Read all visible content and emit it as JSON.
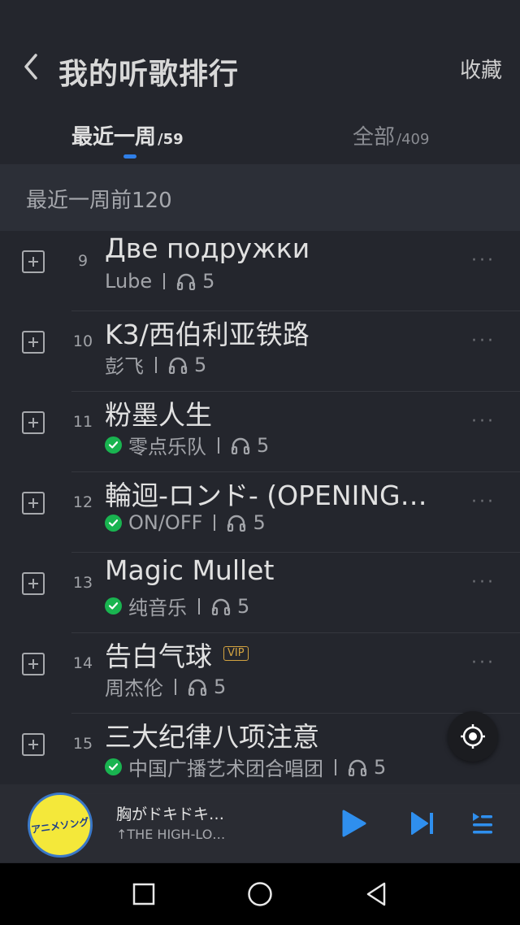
{
  "header": {
    "title": "我的听歌排行",
    "collect_label": "收藏"
  },
  "tabs": [
    {
      "label": "最近一周",
      "count": "/59",
      "active": true
    },
    {
      "label": "全部",
      "count": "/409",
      "active": false
    }
  ],
  "section": {
    "title": "最近一周前120"
  },
  "songs": [
    {
      "rank": "9",
      "title": "Две подружки",
      "artist": "Lube",
      "plays": "5",
      "downloaded": false,
      "vip": false
    },
    {
      "rank": "10",
      "title": "K3/西伯利亚铁路",
      "artist": "彭飞",
      "plays": "5",
      "downloaded": false,
      "vip": false
    },
    {
      "rank": "11",
      "title": "粉墨人生",
      "artist": "零点乐队",
      "plays": "5",
      "downloaded": true,
      "vip": false
    },
    {
      "rank": "12",
      "title": "輪迴-ロンド- (OPENING…",
      "artist": "ON/OFF",
      "plays": "5",
      "downloaded": true,
      "vip": false
    },
    {
      "rank": "13",
      "title": "Magic Mullet",
      "artist": "纯音乐",
      "plays": "5",
      "downloaded": true,
      "vip": false
    },
    {
      "rank": "14",
      "title": "告白气球",
      "artist": "周杰伦",
      "plays": "5",
      "downloaded": false,
      "vip": true,
      "vip_label": "VIP"
    },
    {
      "rank": "15",
      "title": "三大纪律八项注意",
      "artist": "中国广播艺术团合唱团",
      "plays": "5",
      "downloaded": true,
      "vip": false
    }
  ],
  "player": {
    "title": "胸がドキドキ…",
    "artist": "↑THE HIGH-LO…",
    "album_art_text": "アニメソング"
  },
  "colors": {
    "background": "#24262d",
    "accent": "#2f7fe8",
    "download_green": "#19b450",
    "vip_gold": "#d3a341"
  },
  "icons": {
    "back": "chevron-left-icon",
    "add": "plus-box-icon",
    "headphone": "headphone-icon",
    "more": "more-dots-icon",
    "locate": "locate-icon",
    "play": "play-icon",
    "next": "skip-next-icon",
    "queue": "playlist-icon"
  }
}
